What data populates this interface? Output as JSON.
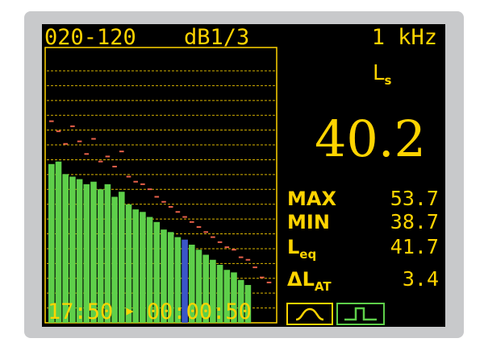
{
  "header": {
    "range": "020-120",
    "mode": "dB1/3",
    "frequency": "1 kHz"
  },
  "parameter": {
    "main": "L",
    "sub": "s"
  },
  "main_value": "40.2",
  "stats": [
    {
      "label": "MAX",
      "label_sub": "",
      "value": "53.7"
    },
    {
      "label": "MIN",
      "label_sub": "",
      "value": "38.7"
    },
    {
      "label": "L",
      "label_sub": "eq",
      "value": "41.7"
    },
    {
      "label": "ΔL",
      "label_sub": "AT",
      "value": "3.4"
    }
  ],
  "footer": {
    "elapsed_clock": "17:50",
    "play_symbol": "▶",
    "timer": "00:00:50"
  },
  "colors": {
    "foreground": "#ffd400",
    "bar": "#5ecf4a",
    "bar_selected": "#3a55c8",
    "max_marker": "#e8604a",
    "background": "#000000"
  },
  "chart_data": {
    "type": "bar",
    "bars": [
      {
        "level": 0.63,
        "max_level": 0.8,
        "selected": false
      },
      {
        "level": 0.64,
        "max_level": 0.76,
        "selected": false
      },
      {
        "level": 0.59,
        "max_level": 0.71,
        "selected": false
      },
      {
        "level": 0.58,
        "max_level": 0.78,
        "selected": false
      },
      {
        "level": 0.57,
        "max_level": 0.72,
        "selected": false
      },
      {
        "level": 0.55,
        "max_level": 0.67,
        "selected": false
      },
      {
        "level": 0.56,
        "max_level": 0.73,
        "selected": false
      },
      {
        "level": 0.53,
        "max_level": 0.64,
        "selected": false
      },
      {
        "level": 0.55,
        "max_level": 0.66,
        "selected": false
      },
      {
        "level": 0.5,
        "max_level": 0.62,
        "selected": false
      },
      {
        "level": 0.52,
        "max_level": 0.68,
        "selected": false
      },
      {
        "level": 0.47,
        "max_level": 0.58,
        "selected": false
      },
      {
        "level": 0.45,
        "max_level": 0.56,
        "selected": false
      },
      {
        "level": 0.44,
        "max_level": 0.55,
        "selected": false
      },
      {
        "level": 0.42,
        "max_level": 0.53,
        "selected": false
      },
      {
        "level": 0.4,
        "max_level": 0.5,
        "selected": false
      },
      {
        "level": 0.37,
        "max_level": 0.48,
        "selected": false
      },
      {
        "level": 0.36,
        "max_level": 0.46,
        "selected": false
      },
      {
        "level": 0.34,
        "max_level": 0.44,
        "selected": false
      },
      {
        "level": 0.33,
        "max_level": 0.42,
        "selected": true
      },
      {
        "level": 0.31,
        "max_level": 0.4,
        "selected": false
      },
      {
        "level": 0.29,
        "max_level": 0.38,
        "selected": false
      },
      {
        "level": 0.27,
        "max_level": 0.36,
        "selected": false
      },
      {
        "level": 0.25,
        "max_level": 0.34,
        "selected": false
      },
      {
        "level": 0.23,
        "max_level": 0.32,
        "selected": false
      },
      {
        "level": 0.21,
        "max_level": 0.3,
        "selected": false
      },
      {
        "level": 0.2,
        "max_level": 0.29,
        "selected": false
      },
      {
        "level": 0.17,
        "max_level": 0.26,
        "selected": false
      },
      {
        "level": 0.15,
        "max_level": 0.25,
        "selected": false
      },
      {
        "level": 0.0,
        "max_level": 0.22,
        "selected": false
      },
      {
        "level": 0.0,
        "max_level": 0.18,
        "selected": false
      },
      {
        "level": 0.0,
        "max_level": 0.16,
        "selected": false
      }
    ],
    "grid": true,
    "gridlines": 17
  }
}
